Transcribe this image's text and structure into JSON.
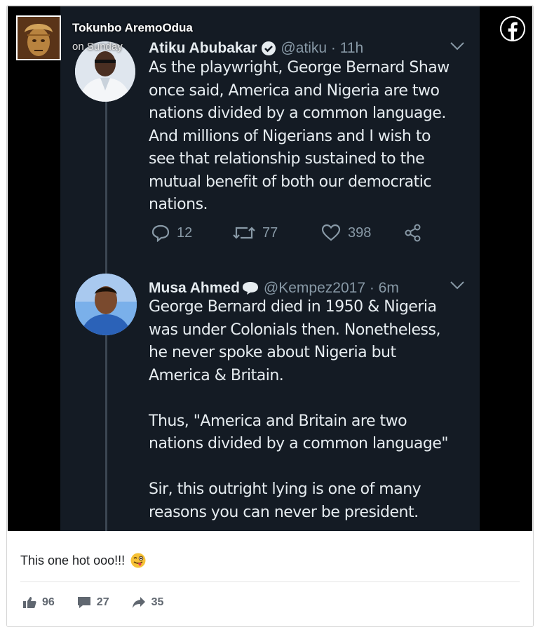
{
  "post": {
    "author": "Tokunbo AremoOdua",
    "time": "on Sunday",
    "caption": "This one hot ooo!!!",
    "caption_emoji": "winking-tongue-face",
    "stats": {
      "likes": "96",
      "comments": "27",
      "shares": "35"
    }
  },
  "tweet1": {
    "name": "Atiku Abubakar",
    "handle": "@atiku · 11h",
    "verified": true,
    "body": "As the playwright, George Bernard Shaw\nonce said, America and Nigeria are two\nnations divided by a common language.\nAnd millions of Nigerians and I wish to\nsee that relationship sustained to the\nmutual benefit of both our democratic\nnations.",
    "replies": "12",
    "retweets": "77",
    "likes": "398"
  },
  "tweet2": {
    "name": "Musa Ahmed",
    "handle": "@Kempez2017 · 6m",
    "body": "George Bernard died in 1950 & Nigeria\nwas under Colonials then. Nonetheless,\nhe never spoke about Nigeria but\nAmerica & Britain.\n\nThus, \"America and Britain are two\nnations divided by a common language\"\n\nSir, this outright lying is one of many\nreasons you can never be president."
  },
  "colors": {
    "tweet_bg": "#141b24",
    "tweet_text": "#e6ecf0",
    "tweet_muted": "#8899a6",
    "facebook_blue": "#1877f2"
  }
}
